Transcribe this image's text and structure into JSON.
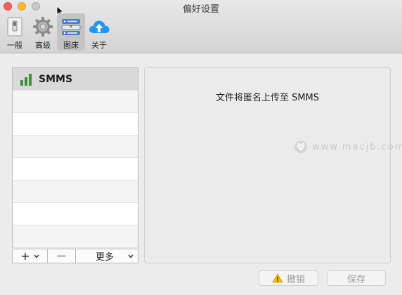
{
  "window": {
    "title": "偏好设置"
  },
  "toolbar": {
    "items": [
      {
        "label": "一般",
        "icon": "general-switch-icon"
      },
      {
        "label": "高级",
        "icon": "gear-icon"
      },
      {
        "label": "图床",
        "icon": "image-host-icon",
        "active": true
      },
      {
        "label": "关于",
        "icon": "cloud-upload-icon"
      }
    ]
  },
  "sidebar": {
    "services": [
      {
        "name": "SMMS",
        "icon": "signal-bars-icon",
        "selected": true
      }
    ],
    "controls": {
      "add": "+",
      "remove": "—",
      "more": "更多"
    }
  },
  "detail": {
    "message": "文件将匿名上传至 SMMS"
  },
  "watermark": {
    "text": "www.macjb.com"
  },
  "actions": {
    "revoke": "撤销",
    "save": "保存"
  },
  "colors": {
    "accent_green": "#3f8f3d",
    "cloud_blue": "#2196f3",
    "warning_yellow": "#f2c200"
  }
}
